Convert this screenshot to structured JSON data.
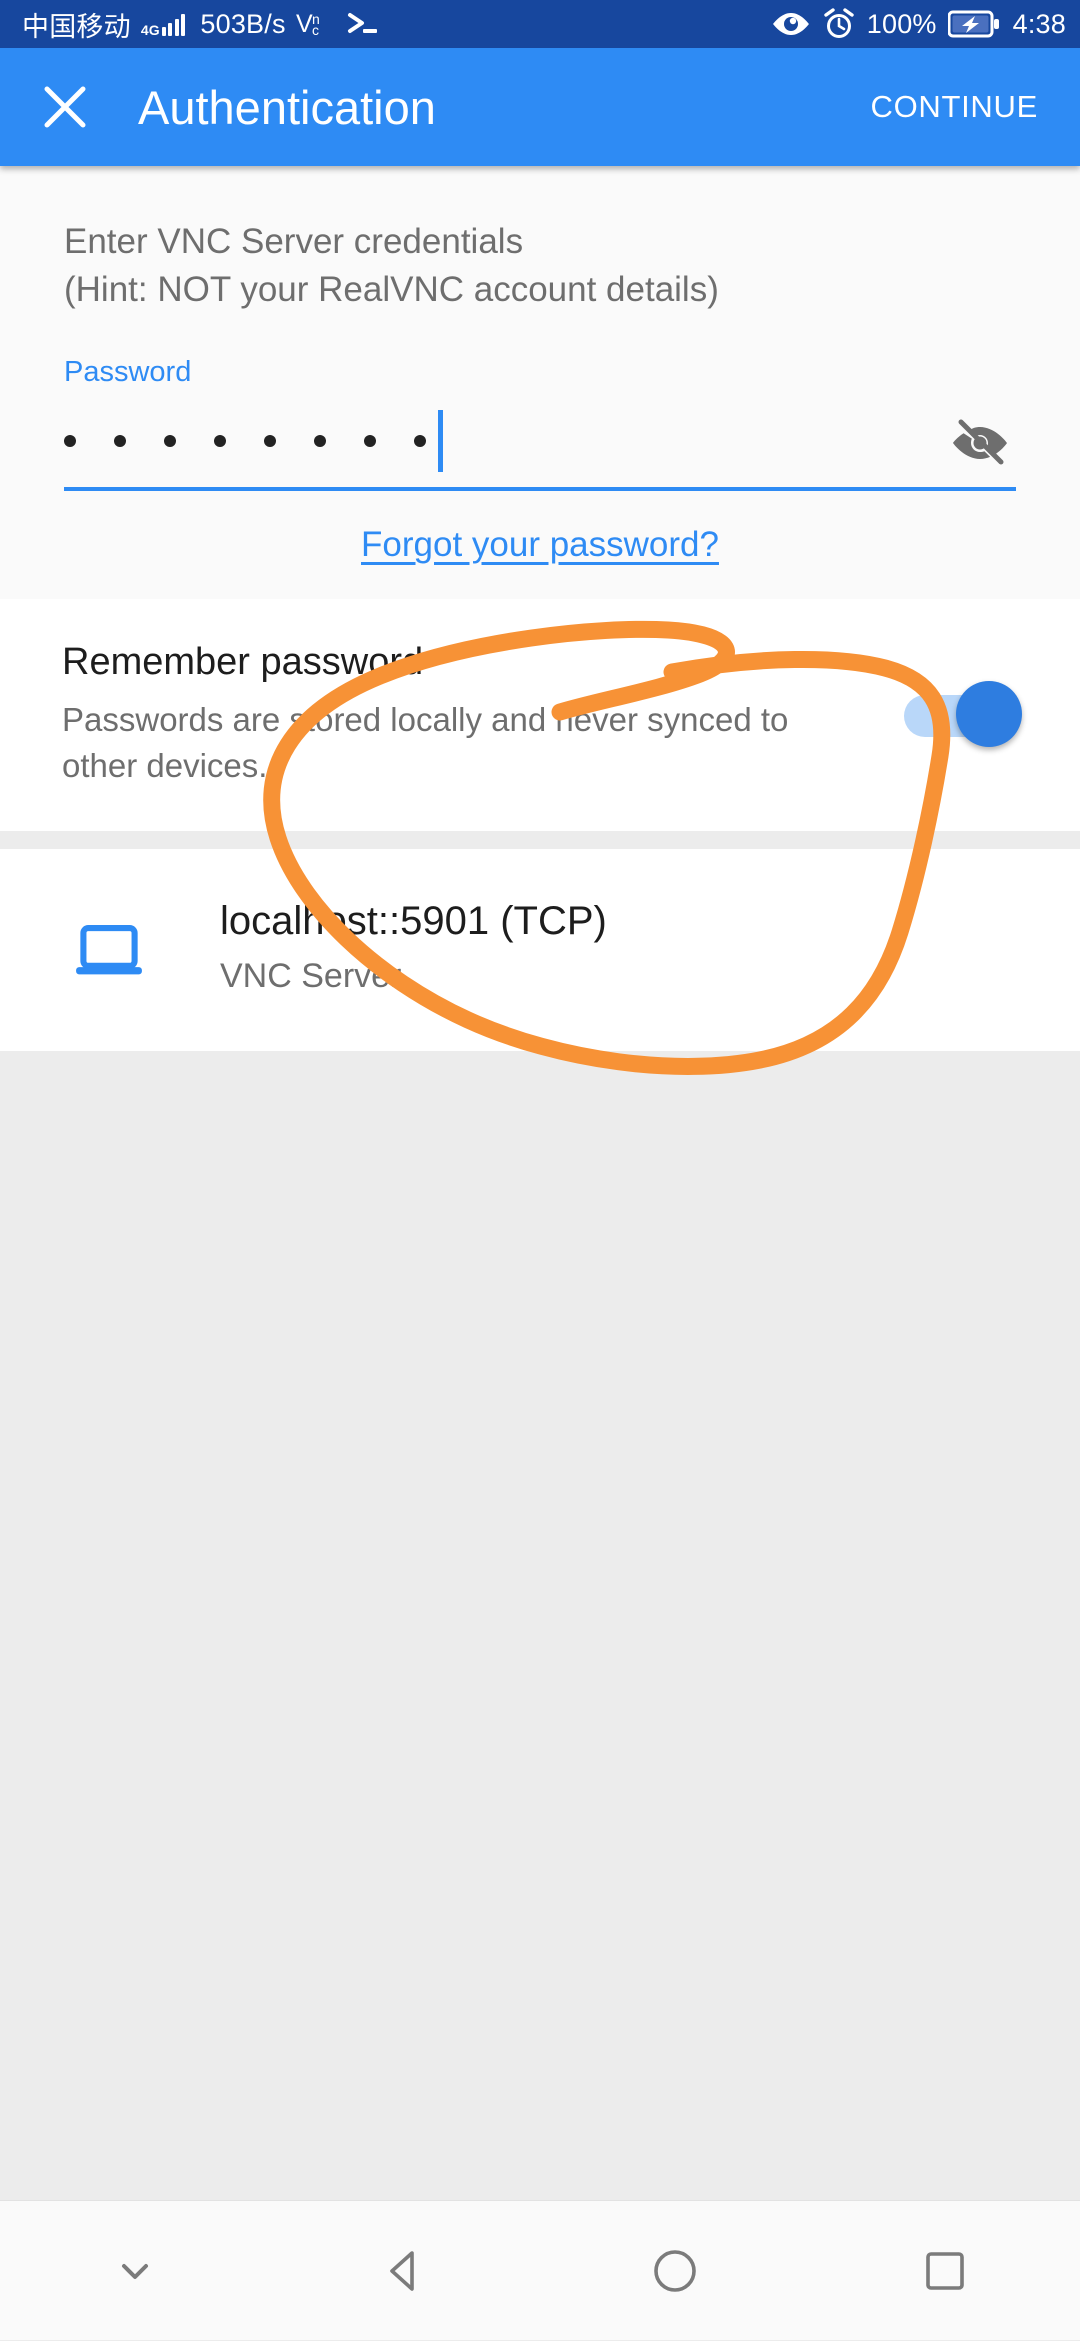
{
  "status_bar": {
    "carrier": "中国移动",
    "network_generation": "4G",
    "network_speed": "503B/s",
    "vnc_icon": "vnc-icon",
    "terminal_icon": "terminal-prompt-icon",
    "eye_icon": "eye-icon",
    "alarm_icon": "alarm-clock-icon",
    "battery_percent": "100%",
    "battery_icon": "battery-charging-icon",
    "time": "4:38",
    "background_color": "#17479e"
  },
  "app_bar": {
    "close_icon": "close-icon",
    "title": "Authentication",
    "continue_label": "CONTINUE",
    "background_color": "#2e8bf4"
  },
  "credentials": {
    "hint_line_1": "Enter VNC Server credentials",
    "hint_line_2": "(Hint: NOT your RealVNC account details)",
    "password_label": "Password",
    "password_value": "••••••••",
    "password_masked_length": 8,
    "password_placeholder": "Password",
    "visibility_icon": "eye-off-icon",
    "forgot_password_label": "Forgot your password?",
    "accent_color": "#2e8bf4"
  },
  "remember": {
    "title": "Remember password",
    "description": "Passwords are stored locally and never synced to other devices.",
    "switch_state": "on",
    "switch_track_color": "#b9d7f9",
    "switch_thumb_color": "#2e7de0"
  },
  "server": {
    "icon": "laptop-icon",
    "icon_color": "#2e8bf4",
    "address": "localhost::5901 (TCP)",
    "subtitle": "VNC Server"
  },
  "annotation": {
    "type": "hand-drawn-ellipse",
    "color": "#f79236",
    "stroke_width": 17,
    "target": "remember-password-row"
  },
  "nav_bar": {
    "items": [
      {
        "name": "hide-keyboard-icon",
        "glyph": "chevron-down"
      },
      {
        "name": "back-icon",
        "glyph": "triangle-left"
      },
      {
        "name": "home-icon",
        "glyph": "circle"
      },
      {
        "name": "recents-icon",
        "glyph": "square"
      }
    ],
    "icon_color": "#7b7b7b",
    "background_color": "#fafafa"
  }
}
